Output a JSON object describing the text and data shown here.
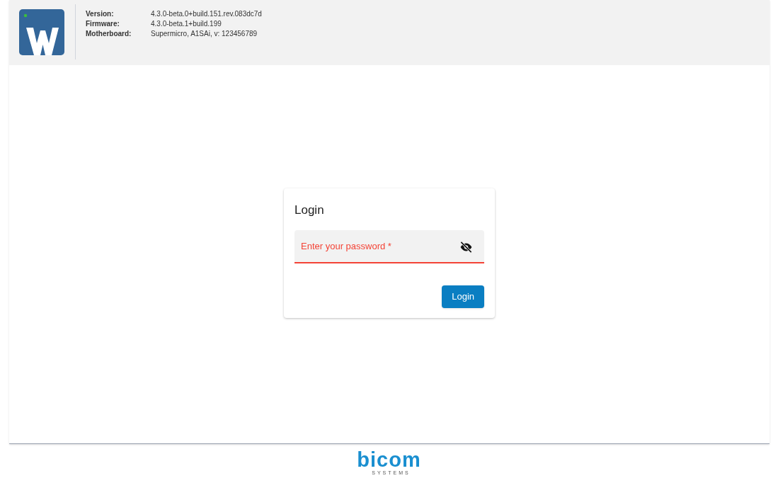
{
  "header": {
    "info": [
      {
        "label": "Version:",
        "value": "4.3.0-beta.0+build.151.rev.083dc7d"
      },
      {
        "label": "Firmware:",
        "value": "4.3.0-beta.1+build.199"
      },
      {
        "label": "Motherboard:",
        "value": "Supermicro, A1SAi, v: 123456789"
      }
    ]
  },
  "login": {
    "title": "Login",
    "password": {
      "placeholder": "Enter your password *",
      "invalid": true
    },
    "button": "Login"
  },
  "footer": {
    "brand": "bicom",
    "tagline": "SYSTEMS"
  }
}
